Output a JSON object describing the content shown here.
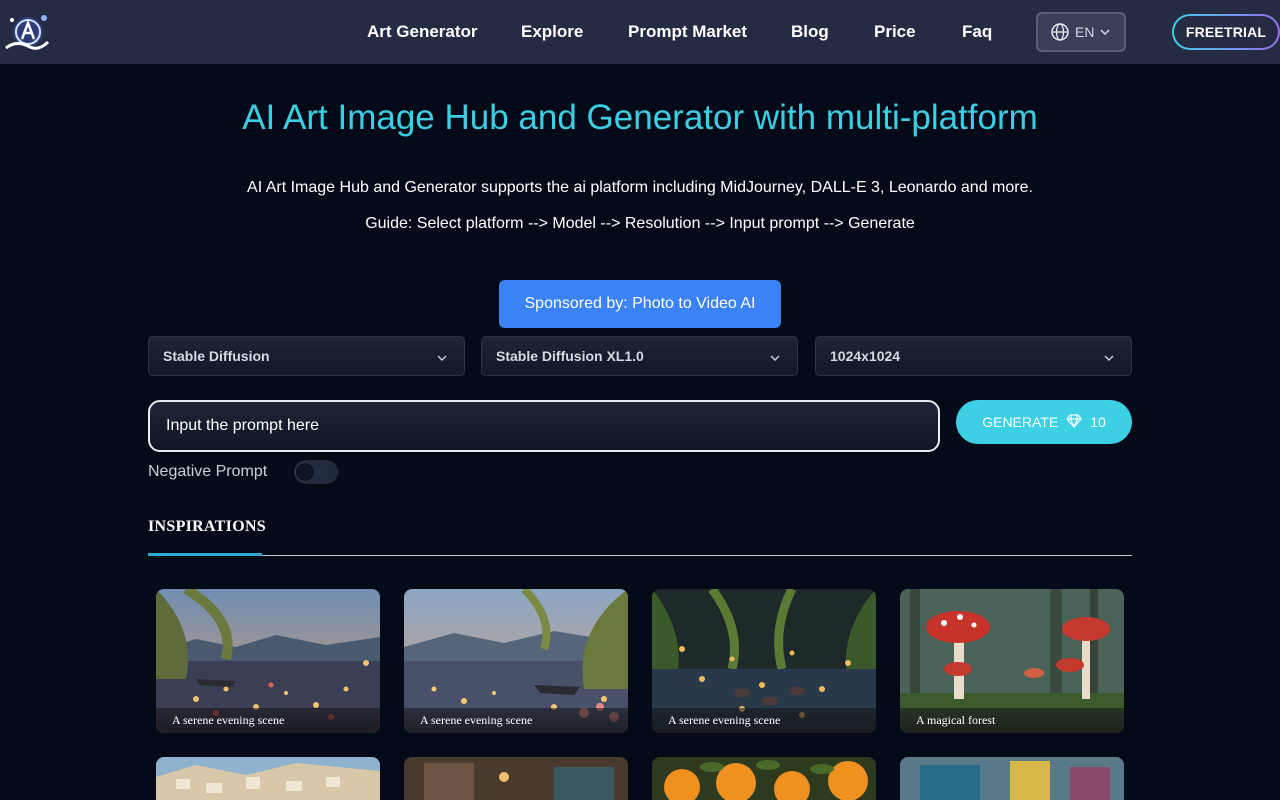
{
  "nav": {
    "items": [
      "Art Generator",
      "Explore",
      "Prompt Market",
      "Blog",
      "Price",
      "Faq"
    ],
    "language": "EN",
    "freetrial": "FREETRIAL"
  },
  "hero": {
    "title": "AI Art Image Hub and Generator with multi-platform",
    "subtitle": "AI Art Image Hub and Generator supports the ai platform including MidJourney, DALL-E 3, Leonardo and more.",
    "guide": "Guide: Select platform --> Model --> Resolution --> Input prompt --> Generate",
    "sponsor": "Sponsored by: Photo to Video AI"
  },
  "controls": {
    "platform": "Stable Diffusion",
    "model": "Stable Diffusion XL1.0",
    "resolution": "1024x1024",
    "prompt_placeholder": "Input the prompt here",
    "generate_label": "GENERATE",
    "generate_cost": "10",
    "negative_prompt_label": "Negative Prompt",
    "negative_prompt_enabled": false
  },
  "tabs": {
    "active": "INSPIRATIONS"
  },
  "gallery": [
    {
      "caption": "A serene evening scene"
    },
    {
      "caption": "A serene evening scene"
    },
    {
      "caption": "A serene evening scene"
    },
    {
      "caption": "A magical forest"
    }
  ],
  "colors": {
    "accent": "#3dcfe3",
    "sponsor": "#3b82f6",
    "header": "#262b44",
    "background": "#050a19"
  }
}
